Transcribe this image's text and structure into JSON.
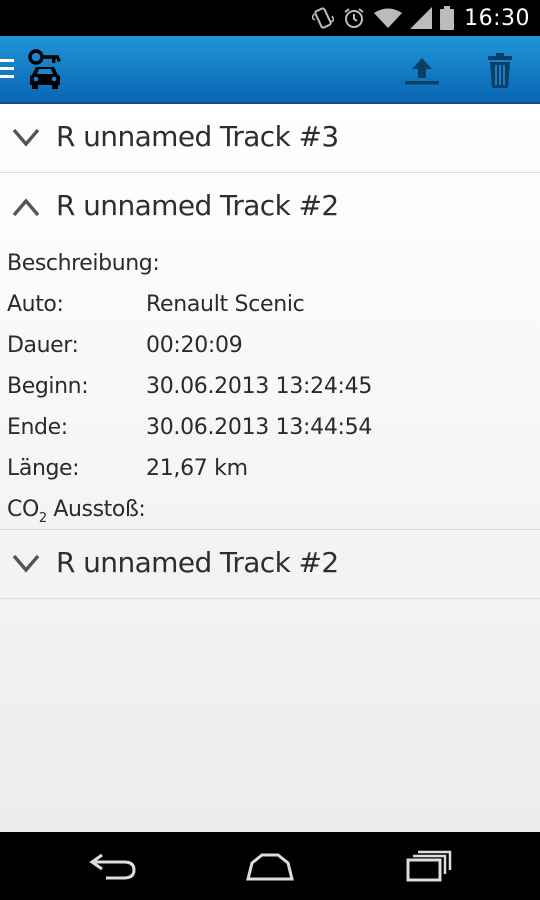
{
  "status_bar": {
    "time": "16:30",
    "icons": [
      "vibrate-icon",
      "alarm-icon",
      "wifi-icon",
      "signal-icon",
      "battery-icon"
    ]
  },
  "action_bar": {
    "colors": {
      "top": "#1f95d6",
      "bottom": "#0a66b3"
    },
    "icons": [
      "menu-icon",
      "car-key-icon",
      "upload-icon",
      "trash-icon"
    ]
  },
  "tracks": [
    {
      "title": "R unnamed Track #3",
      "expanded": false
    },
    {
      "title": "R unnamed Track #2",
      "expanded": true,
      "details": {
        "beschreibung_label": "Beschreibung:",
        "auto_label": "Auto:",
        "auto_value": "Renault Scenic",
        "dauer_label": "Dauer:",
        "dauer_value": "00:20:09",
        "beginn_label": "Beginn:",
        "beginn_value": "30.06.2013 13:24:45",
        "ende_label": "Ende:",
        "ende_value": "30.06.2013 13:44:54",
        "laenge_label": "Länge:",
        "laenge_value": "21,67 km",
        "co2_main": "CO",
        "co2_sub": "2",
        "co2_rest": " Ausstoß:"
      }
    },
    {
      "title": "R unnamed Track #2",
      "expanded": false
    }
  ],
  "nav_bar": {
    "icons": [
      "back-icon",
      "home-icon",
      "recent-apps-icon"
    ]
  }
}
